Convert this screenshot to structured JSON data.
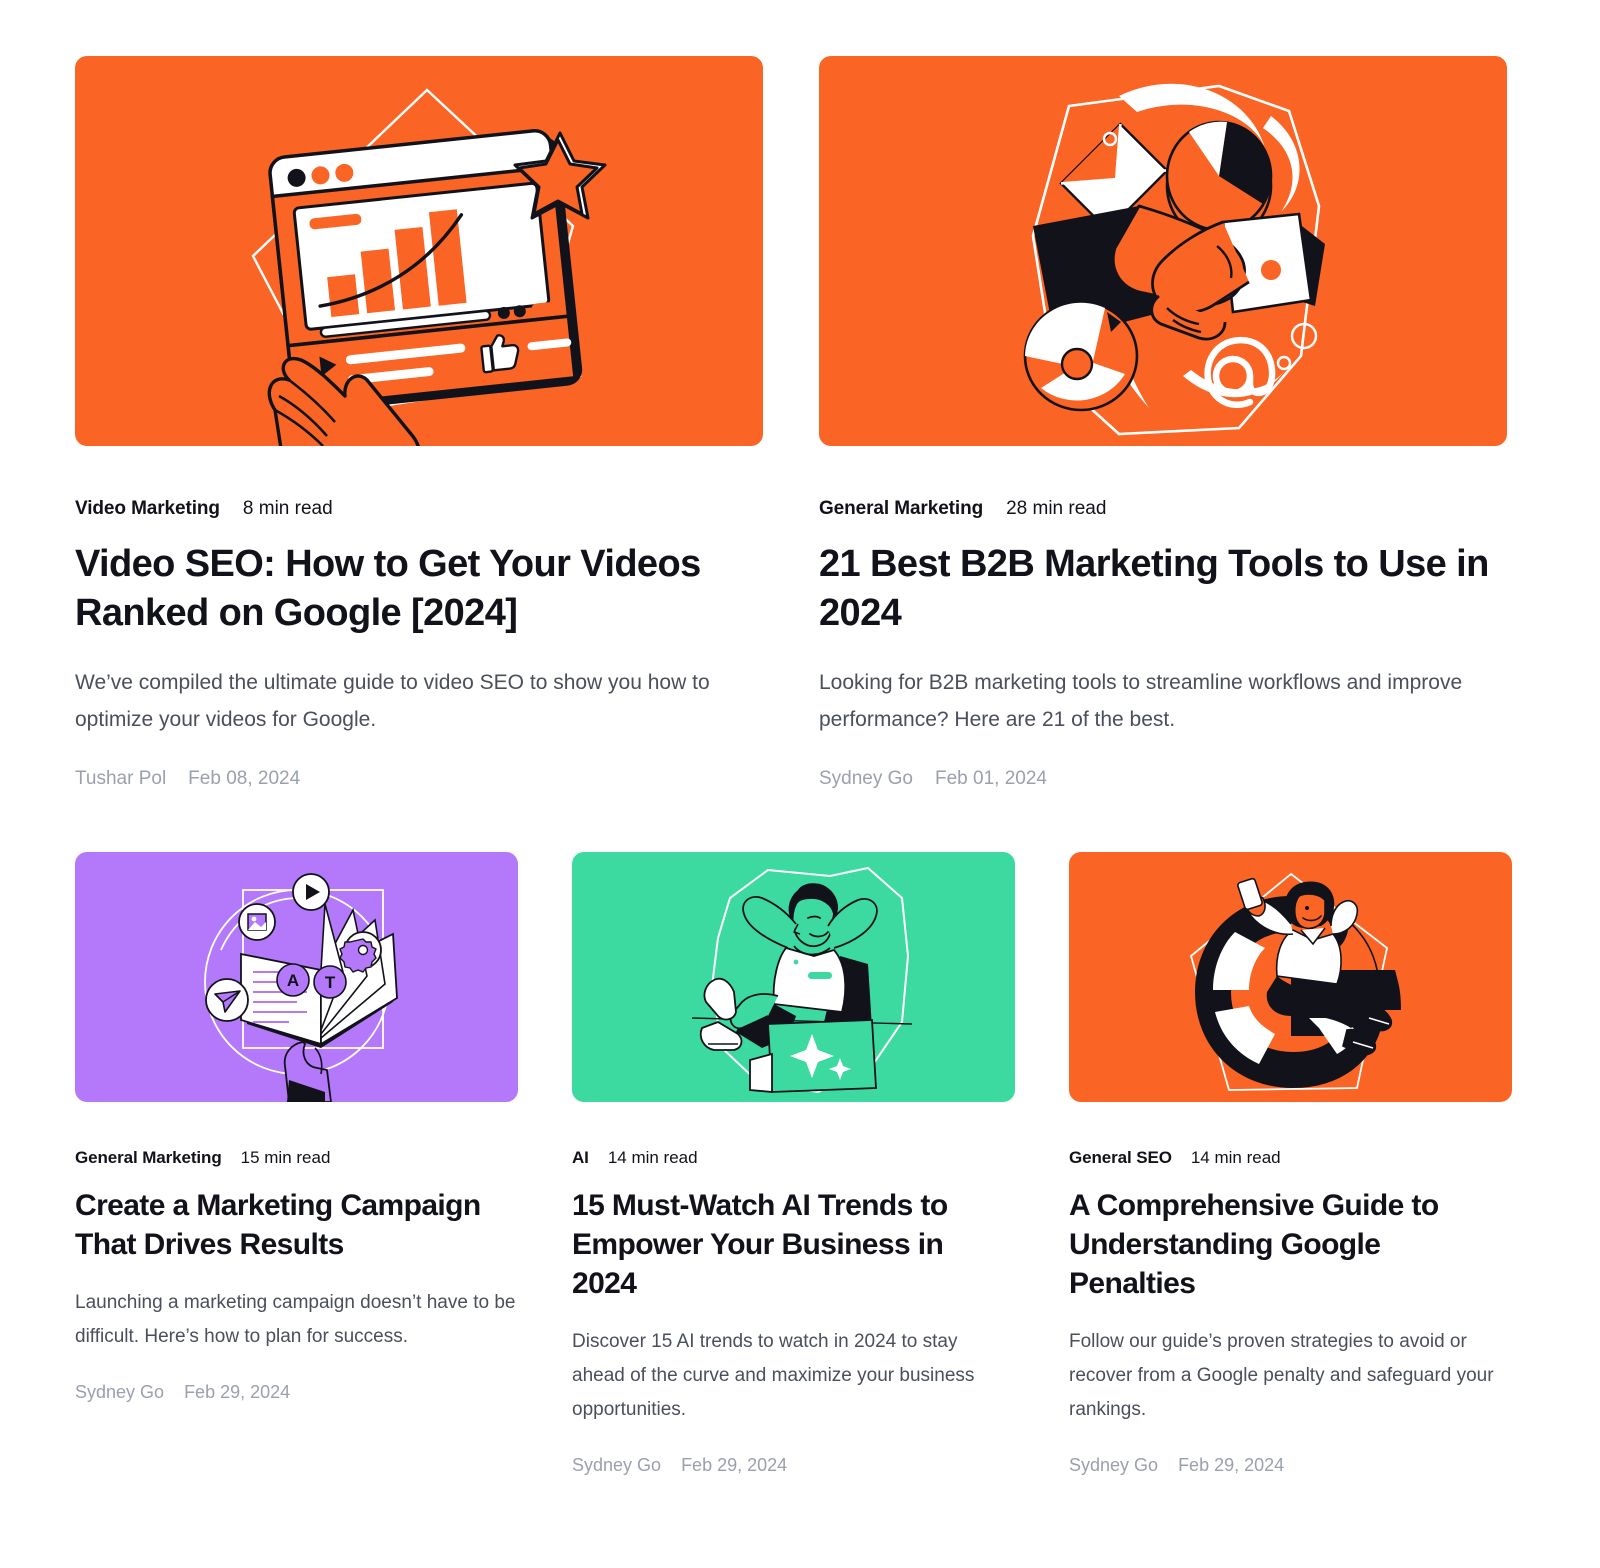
{
  "theme": {
    "background": "#ffffff",
    "text_primary": "#12131a",
    "text_secondary": "#4a4f5c",
    "text_muted": "#9aa0ad",
    "accent_orange": "#fa6425",
    "accent_purple": "#b478fa",
    "accent_green": "#3cd9a0",
    "ink_black": "#12131a",
    "paper_white": "#ffffff"
  },
  "featured": [
    {
      "thumbnail": {
        "icon": "video-analytics-illustration",
        "background": "#fa6425",
        "description": "Hand pointing at a video player window showing a rising bar chart with a star badge and thumbs-up"
      },
      "category": "Video Marketing",
      "read_time": "8 min read",
      "title": "Video SEO: How to Get Your Videos Ranked on Google [2024]",
      "excerpt": "We’ve compiled the ultimate guide to video SEO to show you how to optimize your videos for Google.",
      "author": "Tushar Pol",
      "date": "Feb 08, 2024"
    },
    {
      "thumbnail": {
        "icon": "handshake-illustration",
        "background": "#fa6425",
        "description": "Business handshake surrounded by envelope, pie chart, headset and at-sign icons"
      },
      "category": "General Marketing",
      "read_time": "28 min read",
      "title": "21 Best B2B Marketing Tools to Use in 2024",
      "excerpt": "Looking for B2B marketing tools to streamline workflows and improve performance? Here are 21 of the best.",
      "author": "Sydney Go",
      "date": "Feb 01, 2024"
    }
  ],
  "secondary": [
    {
      "thumbnail": {
        "icon": "open-book-illustration",
        "background": "#b478fa",
        "description": "Hand holding an open book with floating play, image, gear and send icons"
      },
      "category": "General Marketing",
      "read_time": "15 min read",
      "title": "Create a Marketing Campaign That Drives Results",
      "excerpt": "Launching a marketing campaign doesn’t have to be difficult. Here’s how to plan for success.",
      "author": "Sydney Go",
      "date": "Feb 29, 2024"
    },
    {
      "thumbnail": {
        "icon": "relaxed-person-laptop-illustration",
        "background": "#3cd9a0",
        "description": "Person leaning back with hands behind head in front of a laptop showing an AI sparkle"
      },
      "category": "AI",
      "read_time": "14 min read",
      "title": "15 Must-Watch AI Trends to Empower Your Business in 2024",
      "excerpt": "Discover 15 AI trends to watch in 2024 to stay ahead of the curve and maximize your business opportunities.",
      "author": "Sydney Go",
      "date": "Feb 29, 2024"
    },
    {
      "thumbnail": {
        "icon": "woman-on-letter-g-illustration",
        "background": "#fa6425",
        "description": "Woman holding a phone while sitting on a large letter G"
      },
      "category": "General SEO",
      "read_time": "14 min read",
      "title": "A Comprehensive Guide to Understanding Google Penalties",
      "excerpt": "Follow our guide’s proven strategies to avoid or recover from a Google penalty and safeguard your rankings.",
      "author": "Sydney Go",
      "date": "Feb 29, 2024"
    }
  ]
}
